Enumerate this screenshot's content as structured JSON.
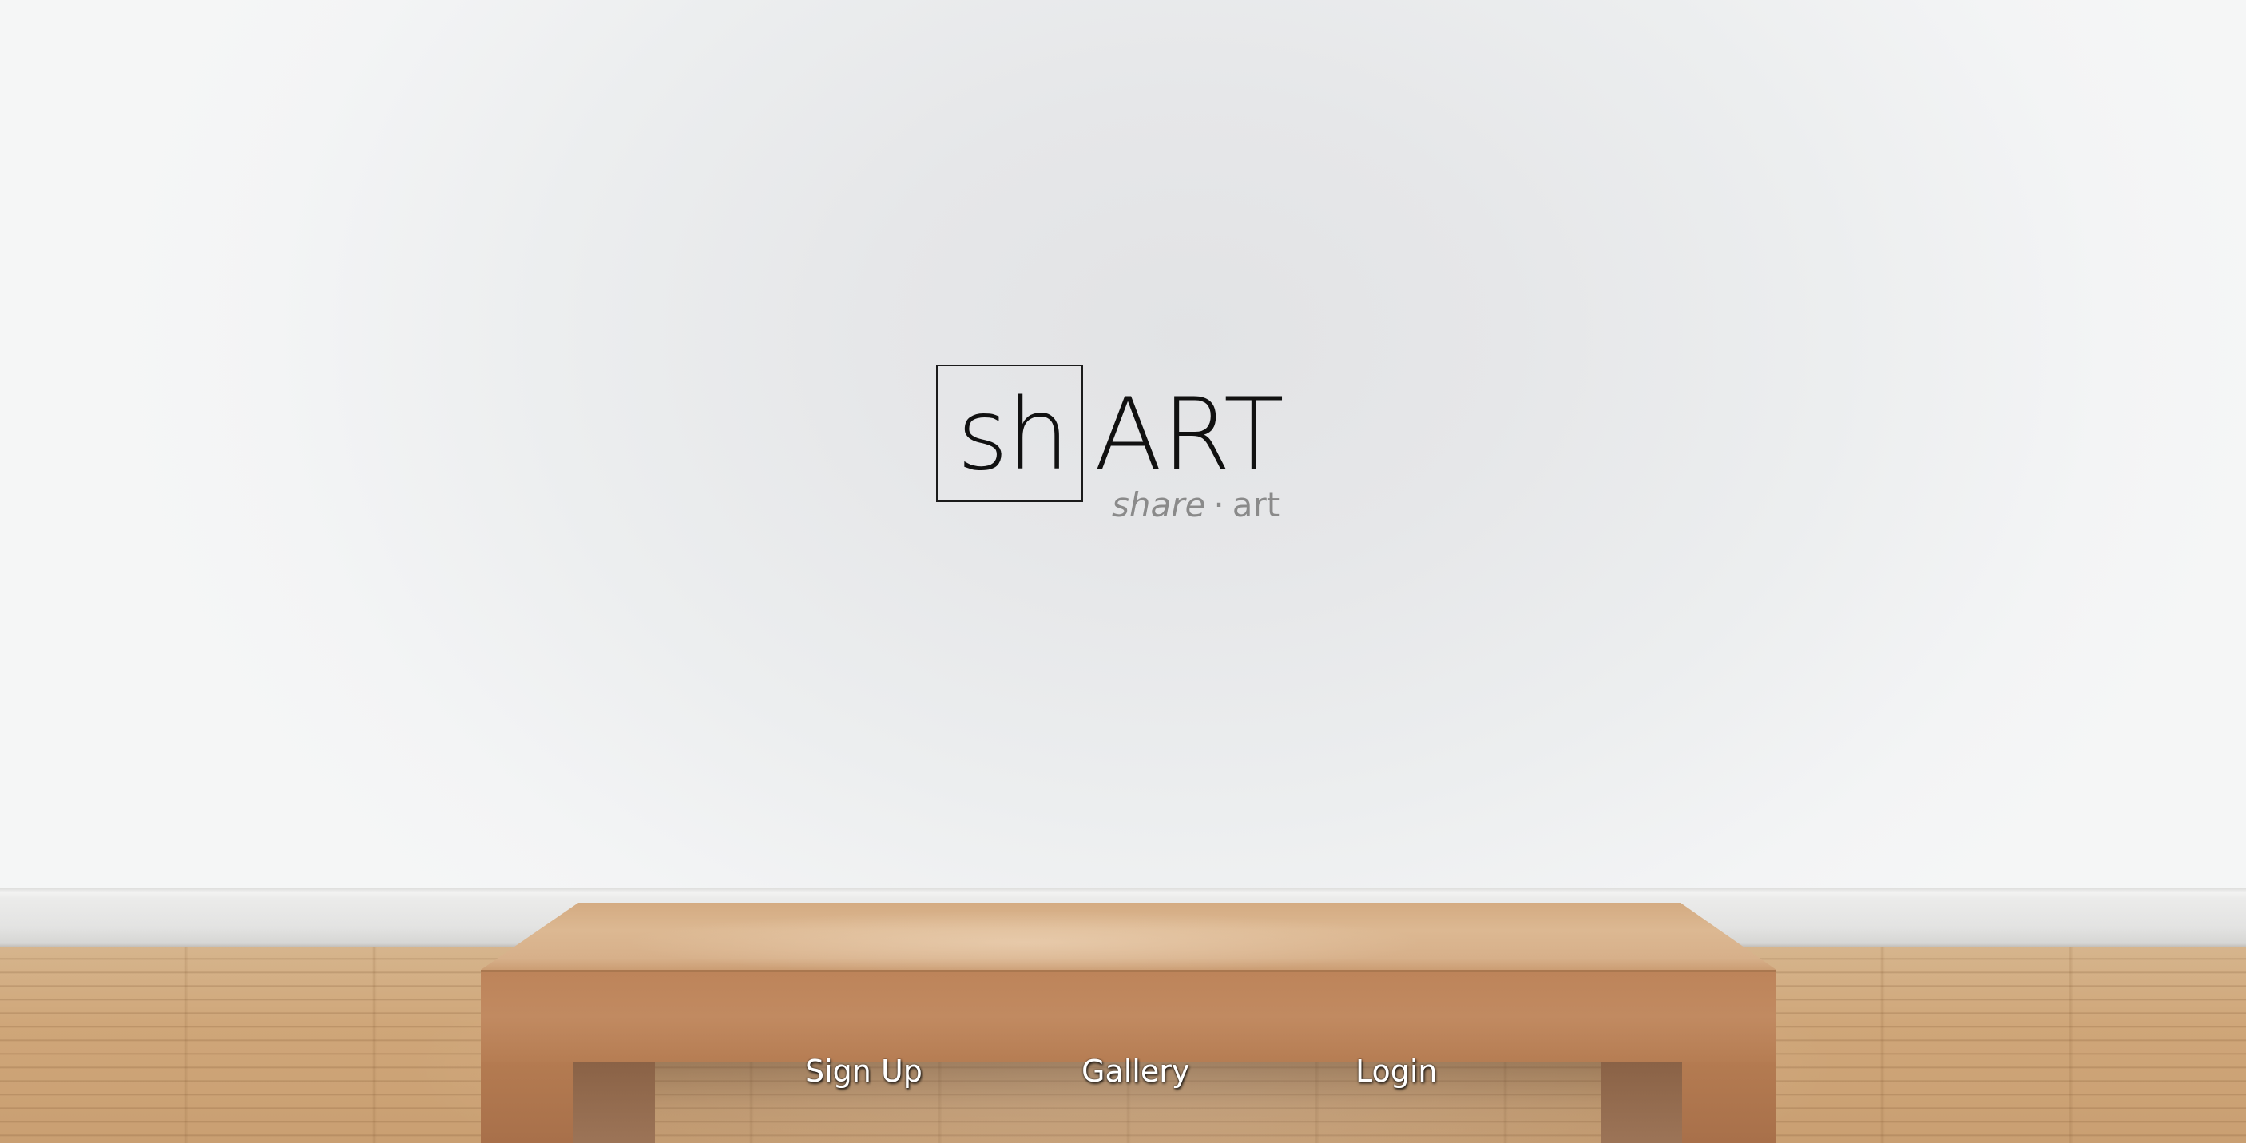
{
  "logo": {
    "boxed_text": "sh",
    "main_text": "ART",
    "tagline_left": "share",
    "tagline_separator": "·",
    "tagline_right": "art"
  },
  "nav": {
    "items": [
      {
        "label": "Sign Up"
      },
      {
        "label": "Gallery"
      },
      {
        "label": "Login"
      }
    ]
  },
  "colors": {
    "wall": "#e6e7e9",
    "logo_text": "#111111",
    "tagline": "#8a8a8a",
    "bench": "#c18a61",
    "floor": "#cfa679",
    "nav_text": "#ffffff"
  }
}
